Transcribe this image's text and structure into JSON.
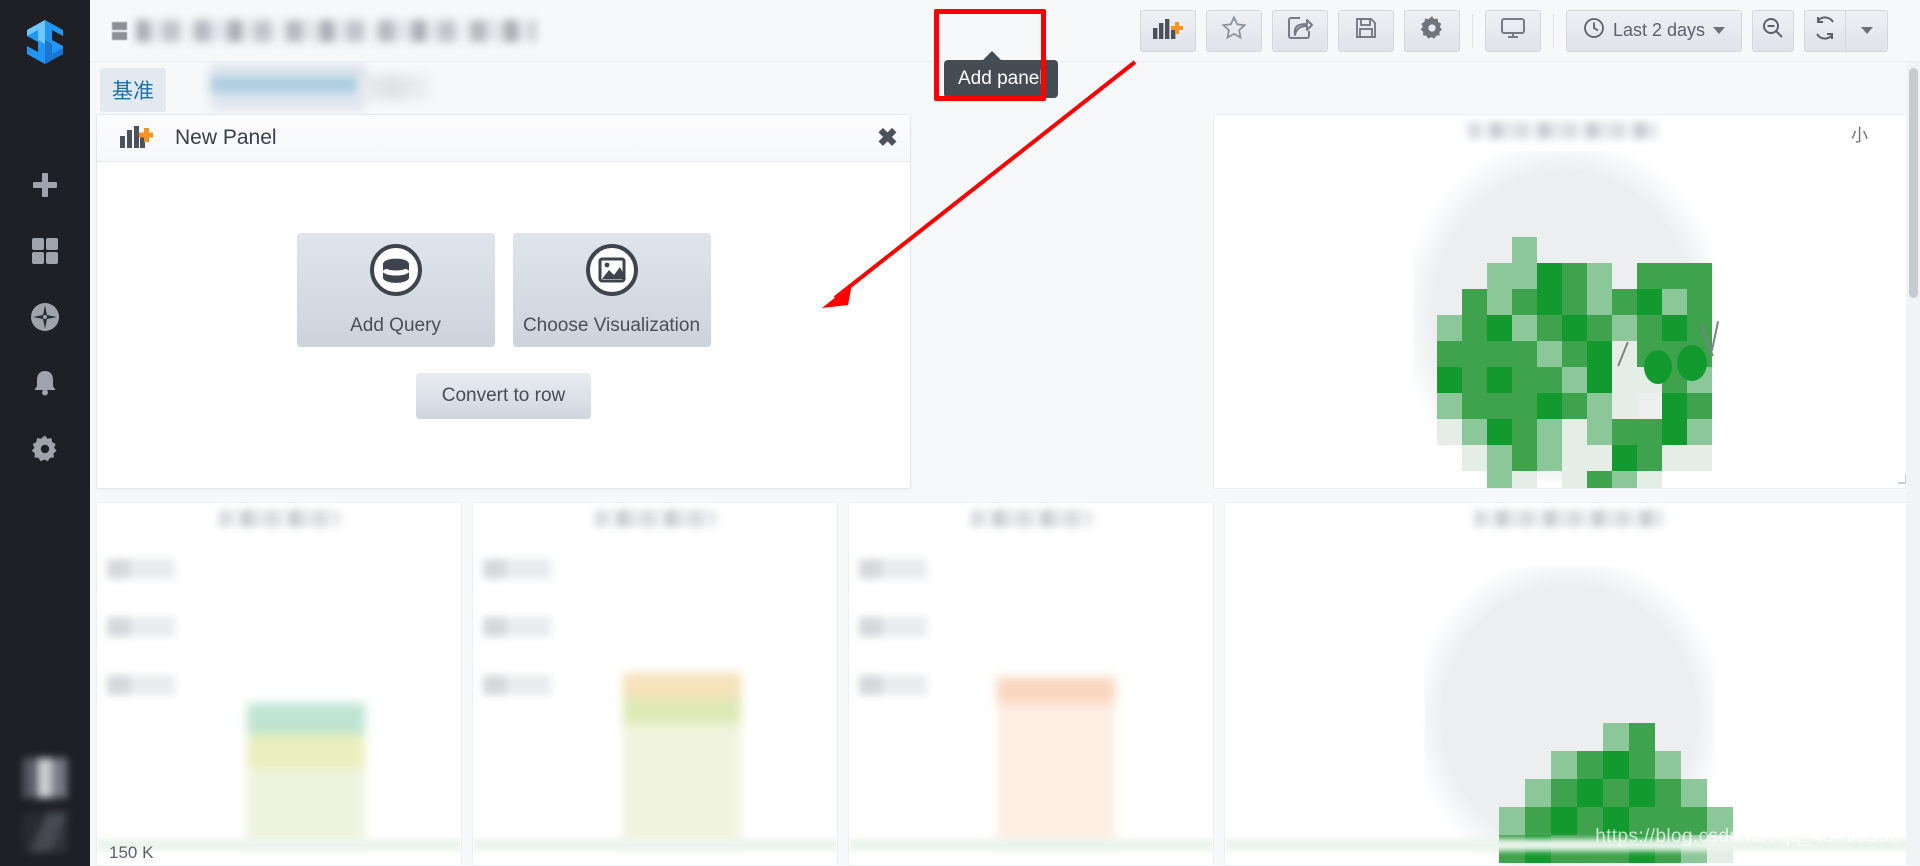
{
  "app": {
    "name": "Grafana",
    "logo_icon": "grafana-logo-icon"
  },
  "sidebar": {
    "items": [
      {
        "icon": "plus-icon",
        "name": "create"
      },
      {
        "icon": "dashboards-grid-icon",
        "name": "dashboards"
      },
      {
        "icon": "compass-icon",
        "name": "explore"
      },
      {
        "icon": "bell-icon",
        "name": "alerting"
      },
      {
        "icon": "gear-icon",
        "name": "configuration"
      }
    ],
    "bottom": [
      {
        "icon": "user-avatar-blurred",
        "name": "user-profile"
      },
      {
        "icon": "help-blurred",
        "name": "help"
      }
    ]
  },
  "topnav": {
    "breadcrumb_icon": "dashboard-icon",
    "breadcrumb_title": "",
    "buttons": [
      {
        "name": "add-panel",
        "icon": "add-panel-icon",
        "tooltip": "Add panel"
      },
      {
        "name": "mark-favorite",
        "icon": "star-icon"
      },
      {
        "name": "share-dashboard",
        "icon": "share-icon"
      },
      {
        "name": "save-dashboard",
        "icon": "save-floppy-icon"
      },
      {
        "name": "dashboard-settings",
        "icon": "gear-icon"
      },
      {
        "name": "tv-kiosk-mode",
        "icon": "monitor-icon"
      }
    ],
    "time_picker": {
      "icon": "clock-icon",
      "label": "Last 2 days",
      "caret": "chevron-down-icon"
    },
    "zoom_out": {
      "icon": "magnifier-minus-icon"
    },
    "refresh": {
      "icon": "refresh-icon"
    },
    "refresh_interval_caret": {
      "icon": "chevron-down-icon"
    }
  },
  "tooltip": {
    "text": "Add panel"
  },
  "submenu": {
    "variable_label": "基准",
    "variable_value": ""
  },
  "new_panel": {
    "icon": "add-panel-icon",
    "title": "New Panel",
    "close_label": "✖",
    "add_query": {
      "label": "Add Query",
      "icon": "database-icon"
    },
    "choose_visualization": {
      "label": "Choose Visualization",
      "icon": "graph-image-icon"
    },
    "convert_to_row": {
      "label": "Convert to row"
    }
  },
  "panels": {
    "green_blob": {
      "title": "",
      "tick_label": "小",
      "resize_handle": "resize-handle-icon"
    },
    "bottom": [
      {
        "title": "",
        "axis_label": "150 K"
      },
      {
        "title": "",
        "axis_label": ""
      },
      {
        "title": "",
        "axis_label": ""
      },
      {
        "title": "",
        "axis_label": ""
      }
    ]
  },
  "watermark": {
    "text": "https://blog.csdn.net/qq_46495338"
  },
  "colors": {
    "sidebar_bg": "#1f2026",
    "accent_blue": "#1f6fa8",
    "logo_blue": "#2196f3",
    "highlight_red": "#ff0000",
    "tooltip_bg": "#464c54",
    "green_dark": "#139a2e",
    "green_mid": "#3fa34d",
    "green_light": "#8cc79a",
    "add_panel_plus": "#f79520"
  }
}
